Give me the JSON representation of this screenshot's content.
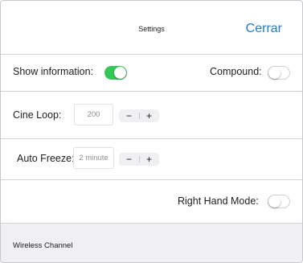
{
  "navbar": {
    "title": "Settings",
    "close_label": "Cerrar"
  },
  "show_information": {
    "label": "Show information:",
    "on": true
  },
  "compound": {
    "label": "Compound:",
    "on": false
  },
  "cine_loop": {
    "label": "Cine Loop:",
    "value": "200",
    "minus": "−",
    "plus": "+"
  },
  "auto_freeze": {
    "label": "Auto Freeze:",
    "value": "2 minute",
    "minus": "−",
    "plus": "+"
  },
  "right_hand_mode": {
    "label": "Right Hand Mode:",
    "on": false
  },
  "wireless_channel": {
    "label": "Wireless Channel"
  },
  "colors": {
    "accent": "#1e7bd8",
    "toggle_on": "#35c759",
    "section_bg": "#efeff4"
  }
}
